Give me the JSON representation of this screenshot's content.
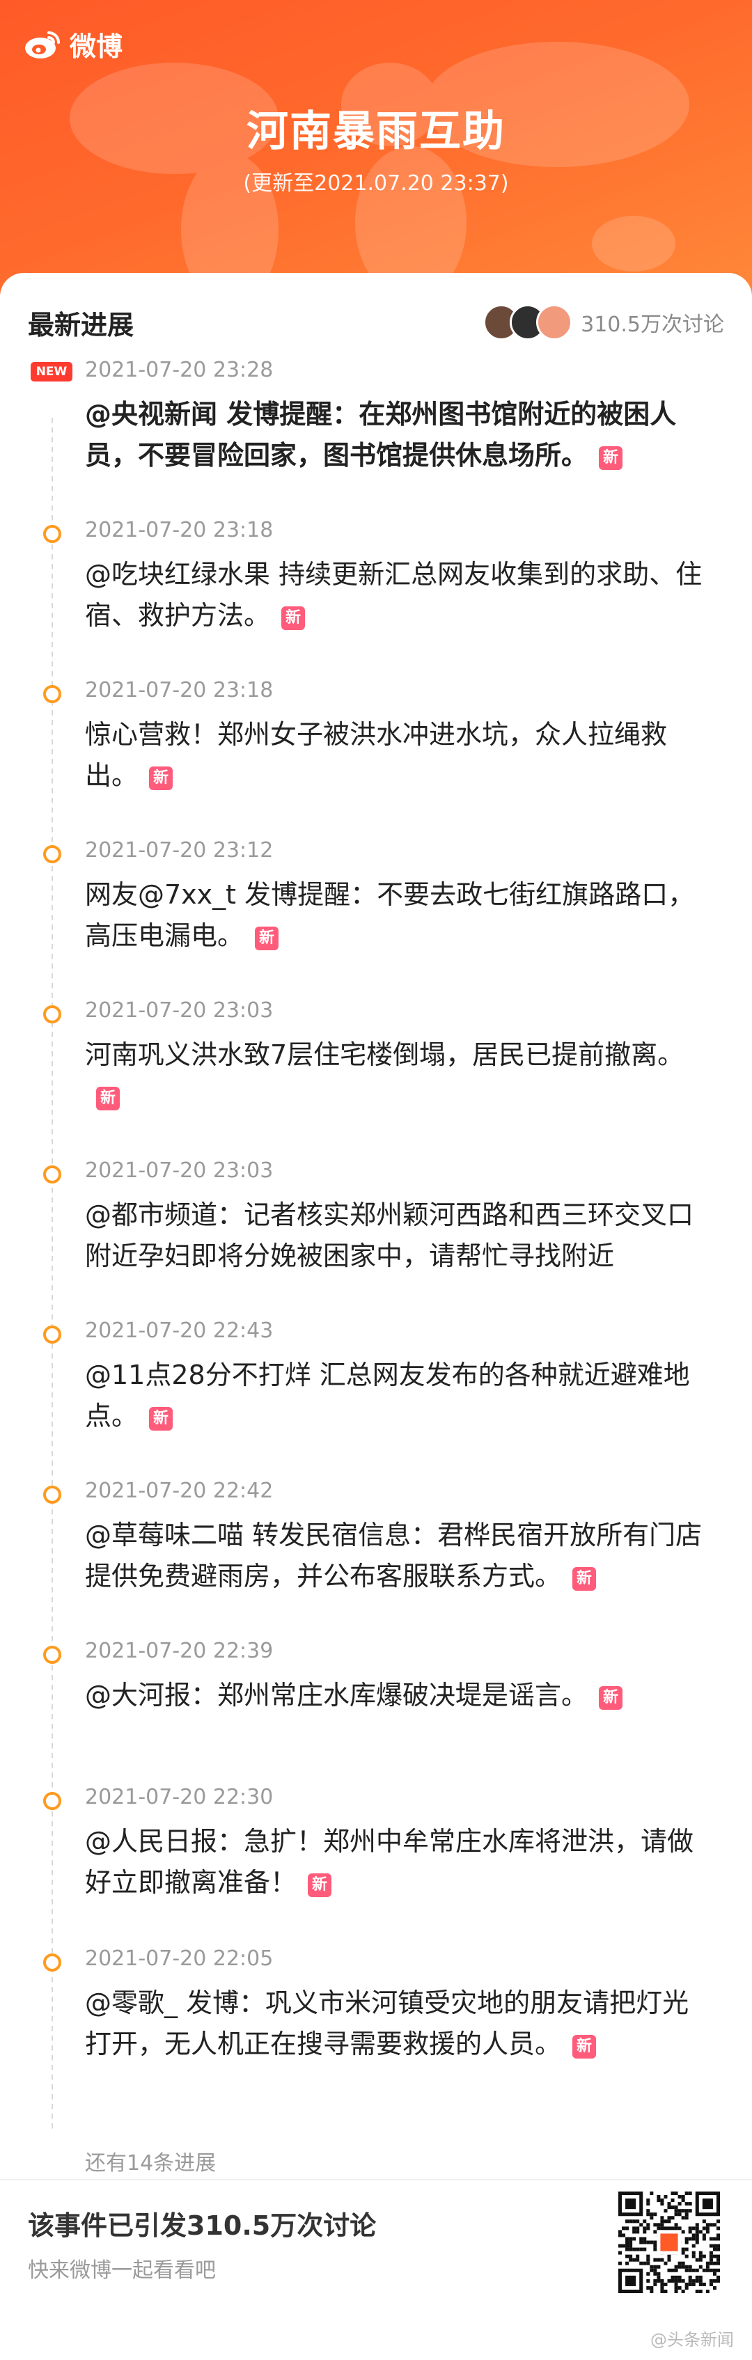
{
  "brand": {
    "name": "微博",
    "logo_icon": "weibo-logo-icon"
  },
  "header": {
    "title": "河南暴雨互助",
    "updated": "(更新至2021.07.20 23:37)"
  },
  "card": {
    "title": "最新进展",
    "discussion_count": "310.5万次讨论"
  },
  "timeline": [
    {
      "tag": "NEW",
      "time": "2021-07-20 23:28",
      "text": "@央视新闻 发博提醒：在郑州图书馆附近的被困人员，不要冒险回家，图书馆提供休息场所。",
      "badge": "新",
      "bold": true
    },
    {
      "time": "2021-07-20 23:18",
      "text": "@吃块红绿水果 持续更新汇总网友收集到的求助、住宿、救护方法。",
      "badge": "新"
    },
    {
      "time": "2021-07-20 23:18",
      "text": "惊心营救！郑州女子被洪水冲进水坑，众人拉绳救出。",
      "badge": "新"
    },
    {
      "time": "2021-07-20 23:12",
      "text": "网友@7xx_t 发博提醒：不要去政七街红旗路路口，高压电漏电。",
      "badge": "新"
    },
    {
      "time": "2021-07-20 23:03",
      "text": "河南巩义洪水致7层住宅楼倒塌，居民已提前撤离。",
      "badge": "新"
    },
    {
      "time": "2021-07-20 23:03",
      "text": "@都市频道：记者核实郑州颖河西路和西三环交叉口附近孕妇即将分娩被困家中，请帮忙寻找附近",
      "badge": ""
    },
    {
      "time": "2021-07-20 22:43",
      "text": "@11点28分不打烊 汇总网友发布的各种就近避难地点。",
      "badge": "新"
    },
    {
      "time": "2021-07-20 22:42",
      "text": "@草莓味二喵 转发民宿信息：君桦民宿开放所有门店提供免费避雨房，并公布客服联系方式。",
      "badge": "新"
    },
    {
      "time": "2021-07-20 22:39",
      "text": "@大河报：郑州常庄水库爆破决堤是谣言。",
      "badge": "新"
    },
    {
      "time": "2021-07-20 22:30",
      "text": "@人民日报：急扩！郑州中牟常庄水库将泄洪，请做好立即撤离准备！",
      "badge": "新"
    },
    {
      "time": "2021-07-20 22:05",
      "text": "@零歌_ 发博：巩义市米河镇受灾地的朋友请把灯光打开，无人机正在搜寻需要救援的人员。",
      "badge": "新"
    }
  ],
  "more": "还有14条进展",
  "footer": {
    "title": "该事件已引发310.5万次讨论",
    "subtitle": "快来微博一起看看吧",
    "qr_icon": "qr-code-icon"
  },
  "watermark": "@头条新闻",
  "colors": {
    "header": "#ff5a28",
    "dot": "#ff9a1e",
    "badge": "#ff5b7b",
    "new_tag": "#ff3b30"
  }
}
